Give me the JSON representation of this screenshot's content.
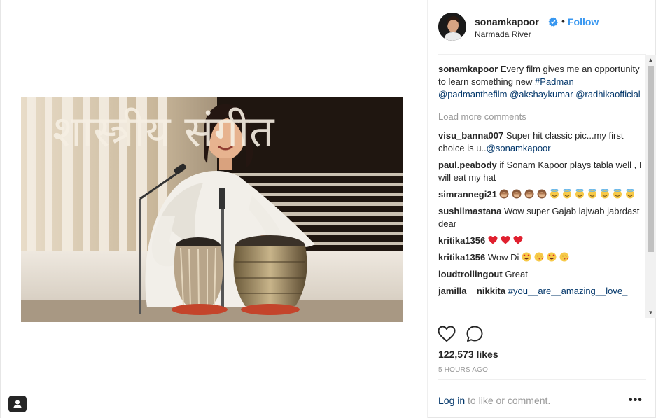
{
  "post": {
    "username": "sonamkapoor",
    "location": "Narmada River",
    "follow_label": "Follow",
    "separator": "•",
    "verified_icon": "verified-badge-icon"
  },
  "caption": {
    "username": "sonamkapoor",
    "text": "Every film gives me an opportunity to learn something new",
    "tags": [
      "#Padman",
      "@padmanthefilm",
      "@akshaykumar",
      "@radhikaofficial"
    ]
  },
  "load_more_label": "Load more comments",
  "comments": [
    {
      "username": "visu_banna007",
      "text": "Super hit classic pic...my first choice is u..",
      "mention": "@sonamkapoor"
    },
    {
      "username": "paul.peabody",
      "text": "if Sonam Kapoor plays tabla well , I will eat my hat"
    },
    {
      "username": "simrannegi21",
      "emojis": [
        "see-no-evil-monkey",
        "see-no-evil-monkey",
        "see-no-evil-monkey",
        "see-no-evil-monkey",
        "smiling-halo",
        "smiling-halo",
        "smiling-halo",
        "smiling-halo",
        "smiling-halo",
        "smiling-halo",
        "smiling-halo"
      ]
    },
    {
      "username": "sushilmastana",
      "text": "Wow super Gajab lajwab jabrdast dear"
    },
    {
      "username": "kritika1356",
      "emojis": [
        "red-heart",
        "red-heart",
        "red-heart"
      ]
    },
    {
      "username": "kritika1356",
      "text": "Wow Di",
      "emojis": [
        "heart-eyes",
        "kiss-face",
        "heart-eyes",
        "kiss-face"
      ]
    },
    {
      "username": "loudtrollingout",
      "text": "Great"
    },
    {
      "username": "jamilla__nikkita",
      "mention": "#you__are__amazing__love_"
    }
  ],
  "stats": {
    "likes": "122,573 likes",
    "time": "5 HOURS AGO"
  },
  "footer": {
    "login_link": "Log in",
    "login_rest": " to like or comment.",
    "more_label": "•••"
  },
  "photo": {
    "backdrop_text": "शास्त्रीय संगीत"
  },
  "colors": {
    "link": "#003569",
    "follow": "#3897f0",
    "muted": "#999999",
    "text": "#262626"
  }
}
